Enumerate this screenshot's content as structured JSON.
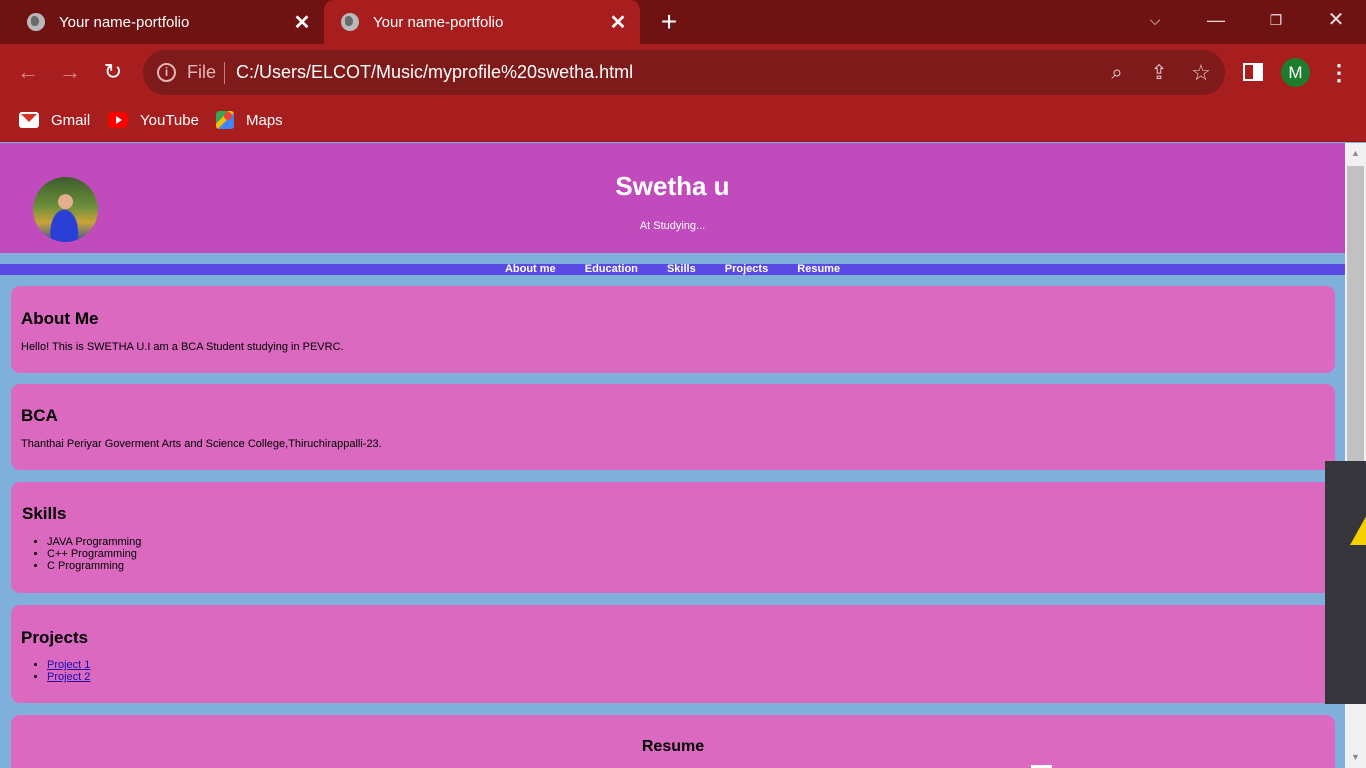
{
  "browser": {
    "tabs": [
      {
        "title": "Your name-portfolio",
        "close": "✕"
      },
      {
        "title": "Your name-portfolio",
        "close": "✕"
      }
    ],
    "new_tab": "+",
    "window_controls": {
      "chevron": "⌵",
      "minimize": "—",
      "restore": "❐",
      "close": "✕"
    },
    "nav": {
      "back": "←",
      "forward": "→",
      "reload": "↻"
    },
    "address": {
      "info": "i",
      "scheme": "File",
      "url": "C:/Users/ELCOT/Music/myprofile%20swetha.html"
    },
    "omnibox_icons": {
      "zoom": "⌕",
      "share": "⇪",
      "star": "☆"
    },
    "profile_initial": "M",
    "menu": "⋮",
    "bookmarks": [
      {
        "label": "Gmail",
        "icon": "gmail-icon"
      },
      {
        "label": "YouTube",
        "icon": "youtube-icon"
      },
      {
        "label": "Maps",
        "icon": "maps-icon"
      }
    ]
  },
  "page": {
    "header": {
      "name": "Swetha u",
      "tagline": "At Studying..."
    },
    "nav": [
      "About me",
      "Education",
      "Skills",
      "Projects",
      "Resume"
    ],
    "about": {
      "heading": "About Me",
      "text": "Hello! This is SWETHA U.I am a BCA Student studying in PEVRC."
    },
    "education": {
      "heading": "BCA",
      "text": "Thanthai Periyar Goverment Arts and Science College,Thiruchirappalli-23."
    },
    "skills": {
      "heading": "Skills",
      "items": [
        "JAVA Programming",
        "C++ Programming",
        "C Programming"
      ]
    },
    "projects": {
      "heading": "Projects",
      "items": [
        "Project 1",
        "Project 2"
      ]
    },
    "resume": {
      "heading": "Resume"
    }
  },
  "scrollbar": {
    "up": "▲",
    "down": "▼"
  },
  "colors": {
    "tabstrip": "#6e1212",
    "toolbar": "#a81d1d",
    "header": "#c14bbd",
    "nav_bar": "#5a49e3",
    "card": "#db69c0",
    "page_bg": "#7fb0dc"
  }
}
